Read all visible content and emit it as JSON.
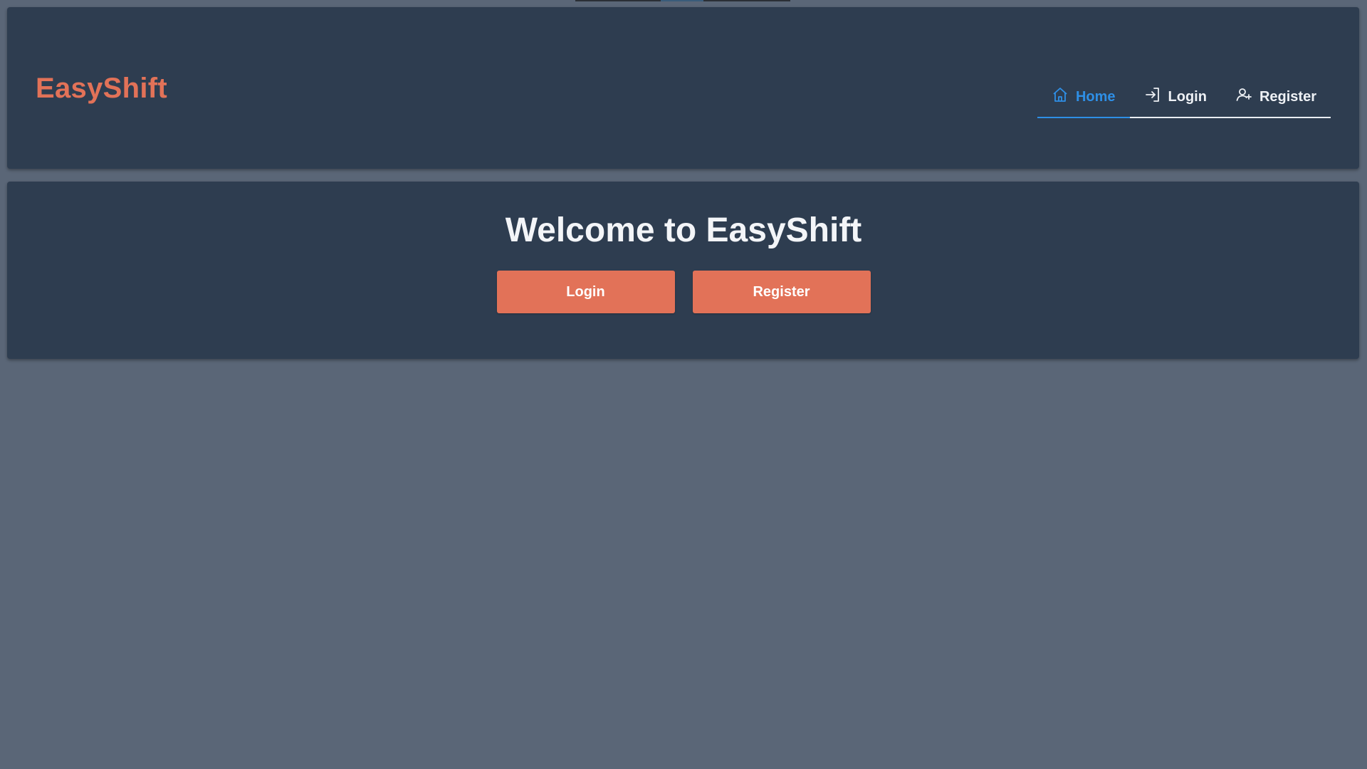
{
  "header": {
    "brand": "EasyShift",
    "nav": [
      {
        "label": "Home",
        "icon": "home-icon",
        "active": true
      },
      {
        "label": "Login",
        "icon": "login-icon",
        "active": false
      },
      {
        "label": "Register",
        "icon": "add-user-icon",
        "active": false
      }
    ]
  },
  "hero": {
    "title": "Welcome to EasyShift",
    "login_label": "Login",
    "register_label": "Register"
  },
  "colors": {
    "background": "#5a6677",
    "card": "#2e3d50",
    "accent": "#e27258",
    "active_nav": "#2e8fe6",
    "text": "#f3f5f8"
  }
}
